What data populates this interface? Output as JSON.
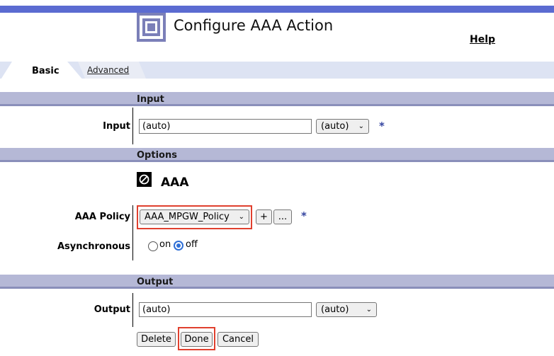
{
  "header": {
    "title": "Configure AAA Action",
    "help": "Help",
    "logo_icon": "nested-square-logo"
  },
  "tabs": [
    {
      "label": "Basic",
      "active": true
    },
    {
      "label": "Advanced",
      "active": false
    }
  ],
  "sections": {
    "input": "Input",
    "options": "Options",
    "output": "Output"
  },
  "input_row": {
    "label": "Input",
    "value": "(auto)",
    "select_value": "(auto)",
    "required_mark": "*"
  },
  "options": {
    "icon": "no-entry-icon",
    "heading": "AAA",
    "policy_label": "AAA Policy",
    "policy_value": "AAA_MPGW_Policy",
    "add_button": "+",
    "edit_button": "...",
    "required_mark": "*",
    "async_label": "Asynchronous",
    "async_on": "on",
    "async_off": "off",
    "async_selected": "off"
  },
  "output_row": {
    "label": "Output",
    "value": "(auto)",
    "select_value": "(auto)"
  },
  "actions": {
    "delete": "Delete",
    "done": "Done",
    "cancel": "Cancel"
  },
  "colors": {
    "top_bar": "#5b6bd1",
    "section_bar": "#b5b8d6",
    "highlight": "#e0402e",
    "required": "#3545a0"
  }
}
